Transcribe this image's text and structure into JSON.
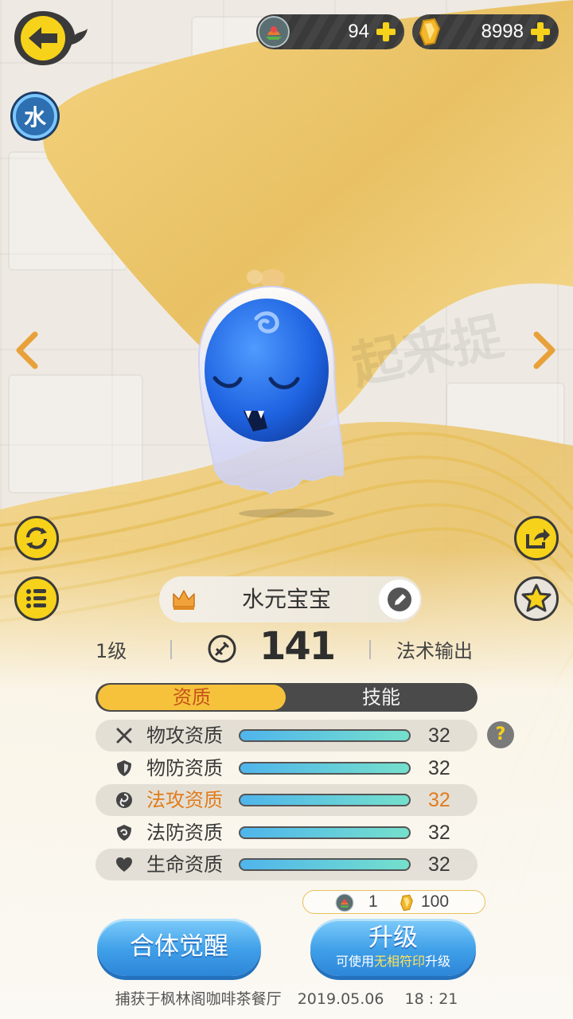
{
  "currencies": {
    "gems": {
      "value": "94",
      "icon": "gem-orb-icon"
    },
    "gold": {
      "value": "8998",
      "icon": "gold-crystal-icon"
    }
  },
  "element_badge": "水",
  "pet": {
    "name": "水元宝宝",
    "level": "1级",
    "power": "141",
    "role": "法术输出"
  },
  "tabs": [
    {
      "label": "资质",
      "active": true
    },
    {
      "label": "技能",
      "active": false
    }
  ],
  "attributes": [
    {
      "label": "物攻资质",
      "value": "32",
      "icon": "sword-cross-icon",
      "fill": 1.0
    },
    {
      "label": "物防资质",
      "value": "32",
      "icon": "shield-icon",
      "fill": 1.0
    },
    {
      "label": "法攻资质",
      "value": "32",
      "icon": "swirl-icon",
      "fill": 1.0,
      "highlight": true
    },
    {
      "label": "法防资质",
      "value": "32",
      "icon": "magic-shield-icon",
      "fill": 1.0
    },
    {
      "label": "生命资质",
      "value": "32",
      "icon": "heart-icon",
      "fill": 1.0
    }
  ],
  "cost": {
    "gems": "1",
    "gold": "100"
  },
  "buttons": {
    "merge": "合体觉醒",
    "upgrade": "升级",
    "upgrade_sub_prefix": "可使用",
    "upgrade_sub_highlight": "无相符印",
    "upgrade_sub_suffix": "升级"
  },
  "capture": {
    "text": "捕获于枫林阁咖啡茶餐厅",
    "date": "2019.05.06",
    "time": "18 : 21"
  },
  "colors": {
    "accent_yellow": "#f7d21a",
    "tab_active": "#f6c23c",
    "highlight_orange": "#e07d1c",
    "button_blue": "#3e9fe8"
  }
}
